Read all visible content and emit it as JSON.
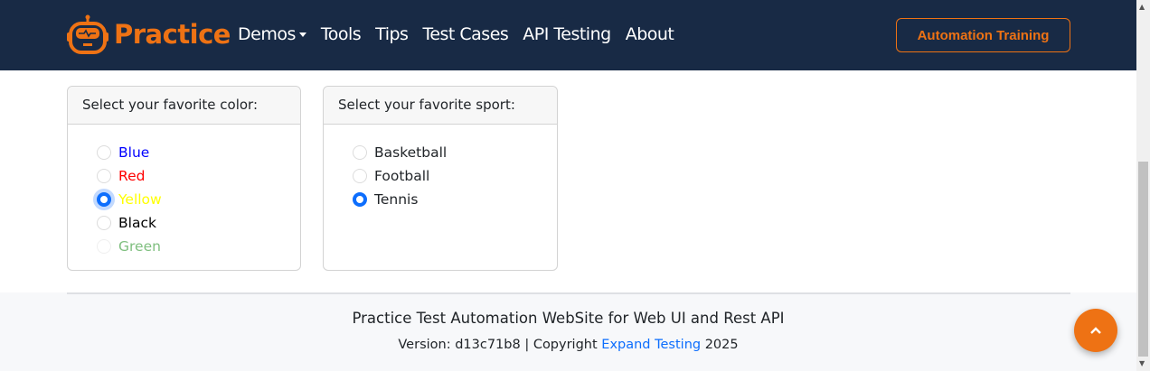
{
  "nav": {
    "brand": "Practice",
    "items": [
      "Demos",
      "Tools",
      "Tips",
      "Test Cases",
      "API Testing",
      "About"
    ],
    "cta": "Automation Training"
  },
  "colors": {
    "accent": "#ee7214",
    "navbar": "#182a45",
    "radio": "#0d6efd"
  },
  "color_card": {
    "title": "Select your favorite color:",
    "options": [
      {
        "label": "Blue",
        "color": "#0000ff",
        "checked": false,
        "disabled": false
      },
      {
        "label": "Red",
        "color": "#ff0000",
        "checked": false,
        "disabled": false
      },
      {
        "label": "Yellow",
        "color": "#ffff00",
        "checked": true,
        "disabled": false
      },
      {
        "label": "Black",
        "color": "#000000",
        "checked": false,
        "disabled": false
      },
      {
        "label": "Green",
        "color": "#7fbf7f",
        "checked": false,
        "disabled": true
      }
    ]
  },
  "sport_card": {
    "title": "Select your favorite sport:",
    "options": [
      {
        "label": "Basketball",
        "checked": false
      },
      {
        "label": "Football",
        "checked": false
      },
      {
        "label": "Tennis",
        "checked": true
      }
    ]
  },
  "footer": {
    "line1": "Practice Test Automation WebSite for Web UI and Rest API",
    "version": "Version: d13c71b8 | Copyright ",
    "link": "Expand Testing",
    "year": " 2025"
  }
}
